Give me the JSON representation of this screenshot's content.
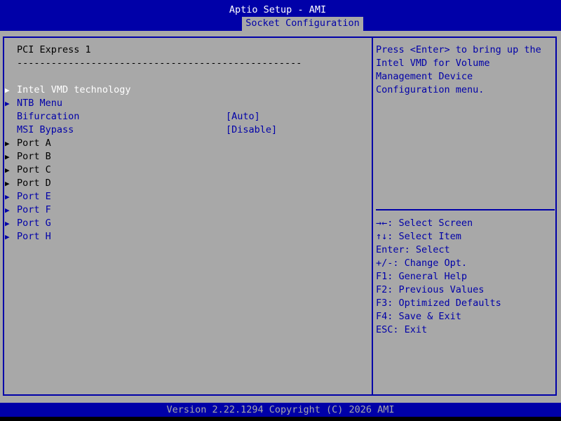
{
  "header": {
    "title": "Aptio Setup - AMI",
    "active_tab": "Socket Configuration"
  },
  "main": {
    "section_title": "PCI Express 1",
    "section_rule": "--------------------------------------------------",
    "items": [
      {
        "label": "Intel VMD technology",
        "value": "",
        "submenu": true,
        "selected": true
      },
      {
        "label": "NTB Menu",
        "value": "",
        "submenu": true
      },
      {
        "label": "Bifurcation",
        "value": "[Auto]",
        "submenu": false
      },
      {
        "label": "MSI Bypass",
        "value": "[Disable]",
        "submenu": false
      },
      {
        "label": "Port A",
        "value": "",
        "submenu": true
      },
      {
        "label": "Port B",
        "value": "",
        "submenu": true
      },
      {
        "label": "Port C",
        "value": "",
        "submenu": true
      },
      {
        "label": "Port D",
        "value": "",
        "submenu": true
      },
      {
        "label": "Port E",
        "value": "",
        "submenu": true
      },
      {
        "label": "Port F",
        "value": "",
        "submenu": true
      },
      {
        "label": "Port G",
        "value": "",
        "submenu": true
      },
      {
        "label": "Port H",
        "value": "",
        "submenu": true
      }
    ]
  },
  "help": {
    "description": [
      "Press <Enter> to bring up the",
      "Intel VMD for Volume",
      "Management Device",
      "Configuration menu."
    ],
    "keys": [
      "→←: Select Screen",
      "↑↓: Select Item",
      "Enter: Select",
      "+/-: Change Opt.",
      "F1: General Help",
      "F2: Previous Values",
      "F3: Optimized Defaults",
      "F4: Save & Exit",
      "ESC: Exit"
    ]
  },
  "footer": {
    "text": "Version 2.22.1294 Copyright (C) 2026 AMI"
  },
  "colors": {
    "bios_blue": "#0000a8",
    "bios_gray": "#a8a8a8",
    "selected_text": "#ffffff",
    "active_text": "#000000"
  },
  "icons": {
    "submenu": "triangle-right-icon"
  }
}
